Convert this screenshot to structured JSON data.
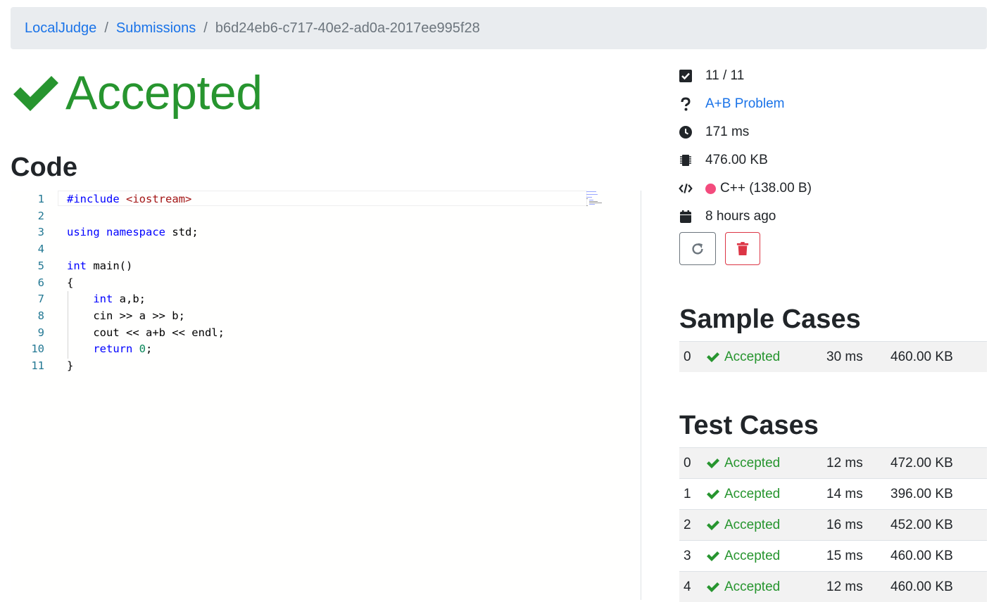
{
  "breadcrumb": {
    "home": "LocalJudge",
    "section": "Submissions",
    "current": "b6d24eb6-c717-40e2-ad0a-2017ee995f28"
  },
  "verdict": {
    "label": "Accepted",
    "icon": "check-icon",
    "color": "#27952f"
  },
  "code_heading": "Code",
  "code": {
    "lines": [
      {
        "n": "1",
        "tokens": [
          {
            "t": "#include ",
            "c": "kw"
          },
          {
            "t": "<iostream>",
            "c": "str"
          }
        ]
      },
      {
        "n": "2",
        "tokens": []
      },
      {
        "n": "3",
        "tokens": [
          {
            "t": "using",
            "c": "kw"
          },
          {
            "t": " ",
            "c": ""
          },
          {
            "t": "namespace",
            "c": "kw"
          },
          {
            "t": " std;",
            "c": ""
          }
        ]
      },
      {
        "n": "4",
        "tokens": []
      },
      {
        "n": "5",
        "tokens": [
          {
            "t": "int",
            "c": "kw"
          },
          {
            "t": " main()",
            "c": ""
          }
        ]
      },
      {
        "n": "6",
        "tokens": [
          {
            "t": "{",
            "c": ""
          }
        ]
      },
      {
        "n": "7",
        "tokens": [
          {
            "t": "    ",
            "c": ""
          },
          {
            "t": "int",
            "c": "kw"
          },
          {
            "t": " a,b;",
            "c": ""
          }
        ]
      },
      {
        "n": "8",
        "tokens": [
          {
            "t": "    cin >> a >> b;",
            "c": ""
          }
        ]
      },
      {
        "n": "9",
        "tokens": [
          {
            "t": "    cout << a+b << endl;",
            "c": ""
          }
        ]
      },
      {
        "n": "10",
        "tokens": [
          {
            "t": "    ",
            "c": ""
          },
          {
            "t": "return",
            "c": "kw"
          },
          {
            "t": " ",
            "c": ""
          },
          {
            "t": "0",
            "c": "num"
          },
          {
            "t": ";",
            "c": ""
          }
        ]
      },
      {
        "n": "11",
        "tokens": [
          {
            "t": "}",
            "c": ""
          }
        ]
      }
    ]
  },
  "meta": {
    "tests": "11 / 11",
    "problem": "A+B Problem",
    "time": "171 ms",
    "memory": "476.00 KB",
    "language": "C++ (138.00 B)",
    "language_color": "#f34b7d",
    "submitted": "8 hours ago"
  },
  "sample_cases": {
    "title": "Sample Cases",
    "rows": [
      {
        "idx": "0",
        "verdict": "Accepted",
        "time": "30 ms",
        "memory": "460.00 KB"
      }
    ]
  },
  "test_cases": {
    "title": "Test Cases",
    "rows": [
      {
        "idx": "0",
        "verdict": "Accepted",
        "time": "12 ms",
        "memory": "472.00 KB"
      },
      {
        "idx": "1",
        "verdict": "Accepted",
        "time": "14 ms",
        "memory": "396.00 KB"
      },
      {
        "idx": "2",
        "verdict": "Accepted",
        "time": "16 ms",
        "memory": "452.00 KB"
      },
      {
        "idx": "3",
        "verdict": "Accepted",
        "time": "15 ms",
        "memory": "460.00 KB"
      },
      {
        "idx": "4",
        "verdict": "Accepted",
        "time": "12 ms",
        "memory": "460.00 KB"
      }
    ]
  },
  "colors": {
    "link": "#1a73e8",
    "success": "#27952f",
    "danger": "#dc3545"
  }
}
